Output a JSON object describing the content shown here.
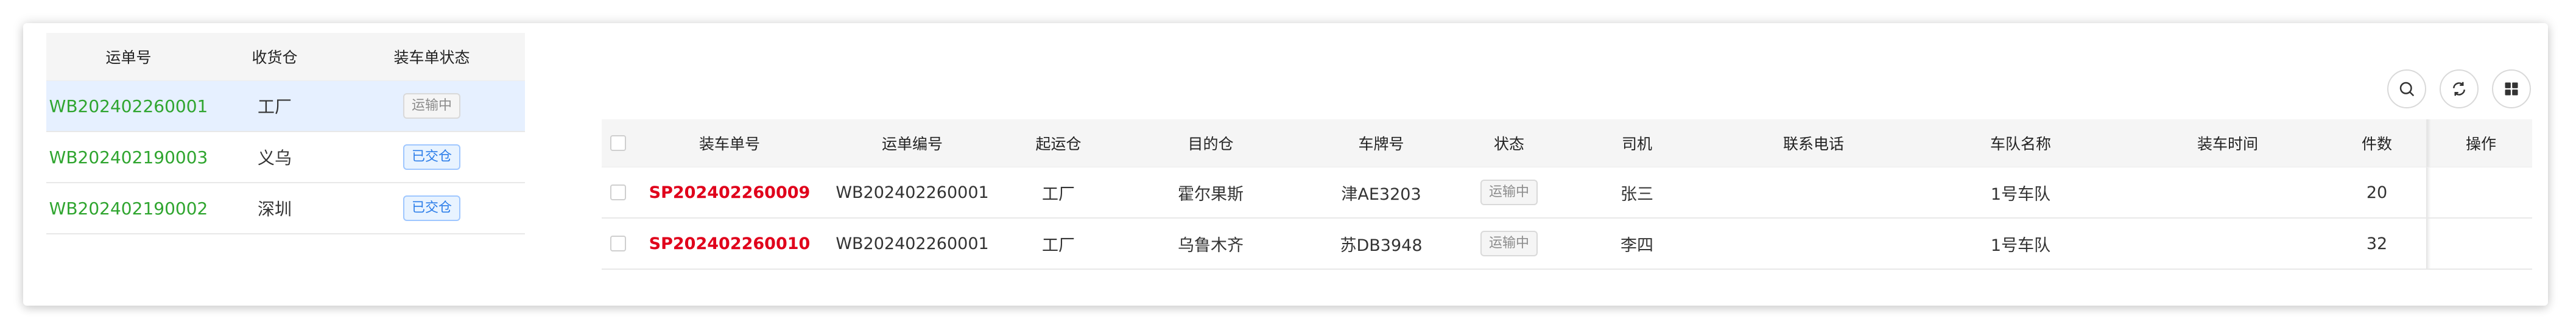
{
  "left_table": {
    "headers": {
      "waybill_no": "运单号",
      "receive_warehouse": "收货仓",
      "loading_status": "装车单状态"
    },
    "rows": [
      {
        "waybill_no": "WB202402260001",
        "warehouse": "工厂",
        "status": "运输中",
        "status_color": "#8c8c8c"
      },
      {
        "waybill_no": "WB202402190003",
        "warehouse": "义乌",
        "status": "已交仓",
        "status_color": "#2b7de9"
      },
      {
        "waybill_no": "WB202402190002",
        "warehouse": "深圳",
        "status": "已交仓",
        "status_color": "#2b7de9"
      }
    ]
  },
  "toolbar": {
    "icons": [
      "search-icon",
      "refresh-icon",
      "grid-icon"
    ]
  },
  "right_table": {
    "headers": {
      "loading_no": "装车单号",
      "waybill_no": "运单编号",
      "origin_warehouse": "起运仓",
      "destination_warehouse": "目的仓",
      "plate_no": "车牌号",
      "status": "状态",
      "driver": "司机",
      "phone": "联系电话",
      "fleet_name": "车队名称",
      "loading_time": "装车时间",
      "pieces": "件数",
      "actions": "操作"
    },
    "rows": [
      {
        "loading_no": "SP202402260009",
        "waybill_no": "WB202402260001",
        "origin": "工厂",
        "destination": "霍尔果斯",
        "plate": "津AE3203",
        "status": "运输中",
        "driver": "张三",
        "phone": "",
        "fleet": "1号车队",
        "loading_time": "",
        "pieces": "20"
      },
      {
        "loading_no": "SP202402260010",
        "waybill_no": "WB202402260001",
        "origin": "工厂",
        "destination": "乌鲁木齐",
        "plate": "苏DB3948",
        "status": "运输中",
        "driver": "李四",
        "phone": "",
        "fleet": "1号车队",
        "loading_time": "",
        "pieces": "32"
      }
    ]
  },
  "colors": {
    "link_green": "#2fa52f",
    "accent_red": "#e0001b",
    "selected_row": "#e6f0ff"
  }
}
